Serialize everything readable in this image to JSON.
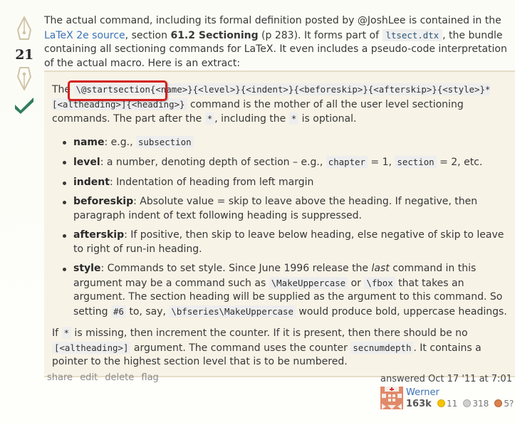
{
  "vote": {
    "count": "21",
    "accepted": true,
    "upvote_icon": "pen-nib-up-icon",
    "downvote_icon": "pen-nib-down-icon",
    "accepted_icon": "checkmark-icon"
  },
  "intro": {
    "t1": "The actual command, including its formal definition posted by @JoshLee is contained in the ",
    "link": "LaTeX 2e source",
    "t2": ", section ",
    "section_bold": "61.2 Sectioning",
    "t3": " (p 283). It forms part of ",
    "code": "ltsect.dtx",
    "t4": ", the bundle containing all sectioning commands for LaTeX. It even includes a pseudo-code interpretation of the actual macro. Here is an extract:"
  },
  "quote": {
    "p1": {
      "t1": "The ",
      "code1": "\\@startsection{<name>}{<level>}{<indent>}{<beforeskip>}{<afterskip>}{<style>}*[<altheading>]{<heading>}",
      "t2": " command is the mother of all the user level sectioning commands. The part after the ",
      "code2": "*",
      "t3": ", including the ",
      "code3": "*",
      "t4": " is optional."
    },
    "items": [
      {
        "term": "name",
        "t1": ": e.g., ",
        "code1": "subsection"
      },
      {
        "term": "level",
        "t1": ": a number, denoting depth of section – e.g., ",
        "code1": "chapter",
        "t2": " = 1, ",
        "code2": "section",
        "t3": " = 2, etc."
      },
      {
        "term": "indent",
        "t1": ": Indentation of heading from left margin"
      },
      {
        "term": "beforeskip",
        "t1": ": Absolute value = skip to leave above the heading. If negative, then paragraph indent of text following heading is suppressed."
      },
      {
        "term": "afterskip",
        "t1": ": If positive, then skip to leave below heading, else negative of skip to leave to right of run-in heading."
      },
      {
        "term": "style",
        "t1": ": Commands to set style. Since June 1996 release the ",
        "em": "last",
        "t2": " command in this argument may be a command such as ",
        "code1": "\\MakeUppercase",
        "t3": " or ",
        "code2": "\\fbox",
        "t4": " that takes an argument. The section heading will be supplied as the argument to this command. So setting ",
        "code3": "#6",
        "t5": " to, say, ",
        "code4": "\\bfseries\\MakeUppercase",
        "t6": " would produce bold, uppercase headings."
      }
    ],
    "p2": {
      "t1": "If ",
      "code1": "*",
      "t2": " is missing, then increment the counter. If it is present, then there should be no ",
      "code2": "[<altheading>]",
      "t3": " argument. The command uses the counter ",
      "code3": "secnumdepth",
      "t4": ". It contains a pointer to the highest section level that is to be numbered."
    }
  },
  "menu": [
    "share",
    "edit",
    "delete",
    "flag"
  ],
  "user": {
    "action": "answered Oct 17 '11 at 7:01",
    "name": "Werner",
    "reputation": "163k",
    "gold": "11",
    "silver": "318",
    "bronze": "5?",
    "colors": {
      "gold": "#f5c400",
      "silver": "#c8c8c8",
      "bronze": "#d9824c",
      "link": "#3b73b9",
      "accept": "#2f7d5a",
      "highlight": "#d42020"
    }
  }
}
